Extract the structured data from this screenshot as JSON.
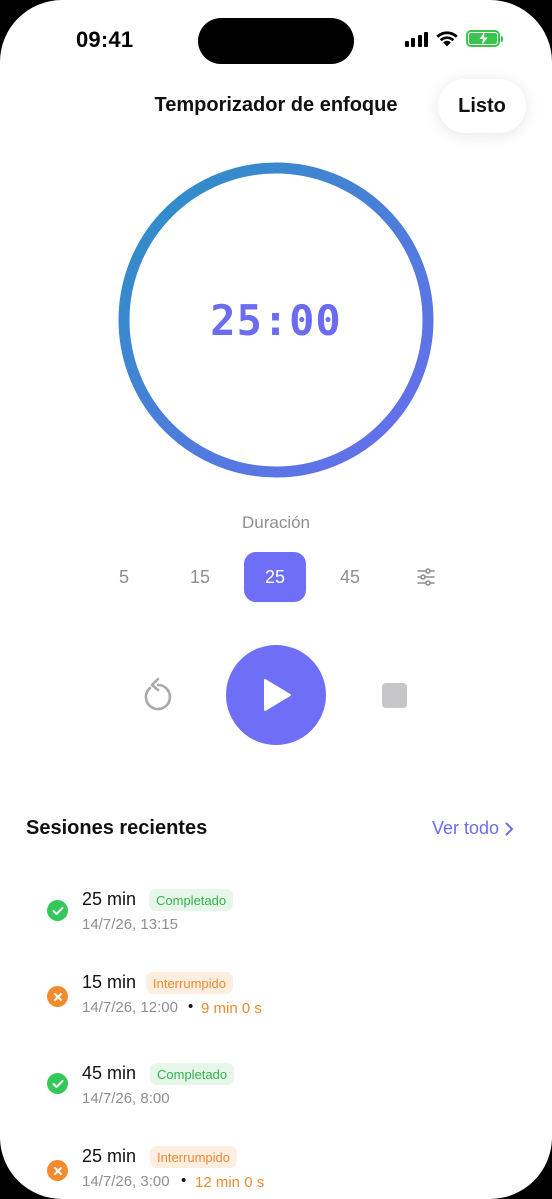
{
  "status_bar": {
    "time": "09:41"
  },
  "header": {
    "title": "Temporizador de enfoque",
    "done_label": "Listo"
  },
  "timer": {
    "display": "25:00",
    "progress": 1.0,
    "gradient_colors": [
      "#2a91c3",
      "#6b6cf0"
    ]
  },
  "duration": {
    "label": "Duración",
    "options": [
      "5",
      "15",
      "25",
      "45"
    ],
    "selected": "25",
    "custom_icon": "sliders-icon"
  },
  "controls": {
    "reset_icon": "reset-icon",
    "play_icon": "play-icon",
    "stop_icon": "stop-icon"
  },
  "recent": {
    "title": "Sesiones recientes",
    "see_all_label": "Ver todo",
    "sessions": [
      {
        "duration": "25 min",
        "status": "Completado",
        "date": "14/7/26, 13:15",
        "extra": ""
      },
      {
        "duration": "15 min",
        "status": "Interrumpido",
        "date": "14/7/26, 12:00",
        "extra": "9 min 0 s"
      },
      {
        "duration": "45 min",
        "status": "Completado",
        "date": "14/7/26, 8:00",
        "extra": ""
      },
      {
        "duration": "25 min",
        "status": "Interrumpido",
        "date": "14/7/26, 3:00",
        "extra": "12 min 0 s"
      }
    ]
  },
  "colors": {
    "accent": "#6e6ef6",
    "success": "#34c759",
    "warning": "#f28a2e"
  }
}
